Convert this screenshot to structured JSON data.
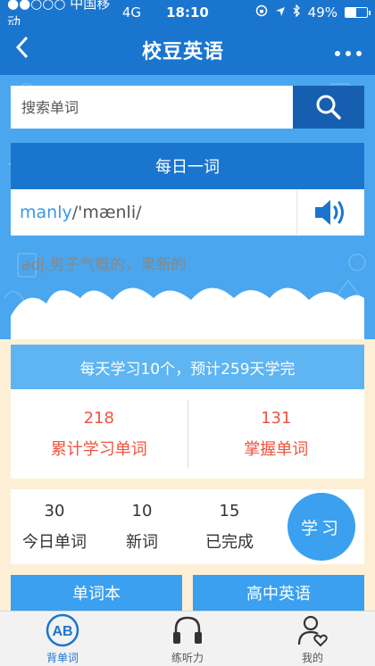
{
  "status_bar": {
    "carrier": "●●○○○ 中国移动",
    "network": "4G",
    "time": "18:10",
    "battery_percent": "49%",
    "battery_level": 0.49
  },
  "nav": {
    "back_icon": "chevron-left",
    "title": "校豆英语",
    "more_icon": "more-dots"
  },
  "search": {
    "placeholder": "搜索单词",
    "icon": "search-icon"
  },
  "daily_word": {
    "header": "每日一词",
    "word": "manly",
    "phonetic": "/'mænli/",
    "meaning": "adj.男子气概的，果断的",
    "sound_icon": "speaker-icon"
  },
  "plan": {
    "text": "每天学习10个，预计259天学完"
  },
  "stats": {
    "total_learned_count": "218",
    "total_learned_label": "累计学习单词",
    "mastered_count": "131",
    "mastered_label": "掌握单词"
  },
  "today": {
    "today_words_count": "30",
    "today_words_label": "今日单词",
    "new_words_count": "10",
    "new_words_label": "新词",
    "completed_count": "15",
    "completed_label": "已完成",
    "learn_button": "学习"
  },
  "books": {
    "wordbook": "单词本",
    "high_school": "高中英语"
  },
  "tabs": [
    {
      "label": "背单词",
      "icon": "ab-icon",
      "active": true
    },
    {
      "label": "练听力",
      "icon": "headphones-icon",
      "active": false
    },
    {
      "label": "我的",
      "icon": "user-heart-icon",
      "active": false
    }
  ],
  "colors": {
    "primary": "#1a75cf",
    "accent": "#3aa0ef",
    "highlight_red": "#f0533e",
    "background": "#fdf0d6"
  }
}
